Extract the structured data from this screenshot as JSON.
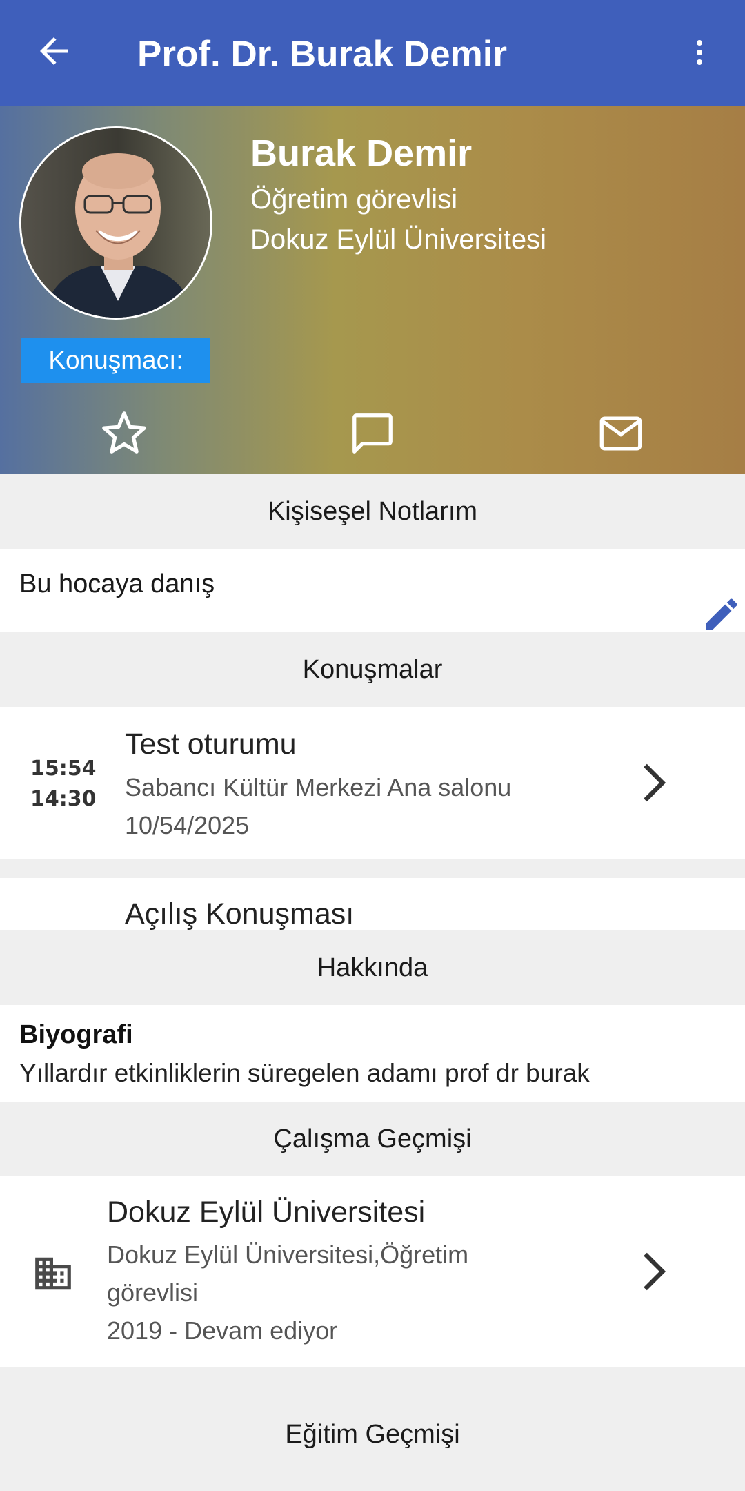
{
  "appbar": {
    "title": "Prof. Dr. Burak Demir",
    "back_icon": "arrow-left-icon",
    "menu_icon": "more-vertical-icon"
  },
  "profile": {
    "name": "Burak Demir",
    "title": "Öğretim görevlisi",
    "organization": "Dokuz Eylül Üniversitesi",
    "badge": "Konuşmacı:",
    "actions": [
      "star-icon",
      "chat-icon",
      "mail-icon"
    ]
  },
  "notes": {
    "header": "Kişiseşel Notlarım",
    "text": "Bu hocaya danış"
  },
  "talks": {
    "header": "Konuşmalar",
    "items": [
      {
        "start": "15:54",
        "end": "14:30",
        "title": "Test oturumu",
        "location": "Sabancı Kültür Merkezi Ana salonu",
        "date": "10/54/2025"
      },
      {
        "title": "Açılış Konuşması"
      }
    ]
  },
  "about": {
    "header": "Hakkında",
    "bio_title": "Biyografi",
    "bio_text": "Yıllardır etkinliklerin süregelen adamı prof dr burak"
  },
  "work": {
    "header": "Çalışma Geçmişi",
    "items": [
      {
        "title": "Dokuz Eylül Üniversitesi",
        "line1": "Dokuz Eylül Üniversitesi,Öğretim",
        "line2": "görevlisi",
        "period": "2019 - Devam ediyor"
      }
    ]
  },
  "education": {
    "header": "Eğitim Geçmişi"
  },
  "colors": {
    "primary": "#3f5fbb",
    "badge": "#1e90ee",
    "edit": "#3f5fbb"
  }
}
